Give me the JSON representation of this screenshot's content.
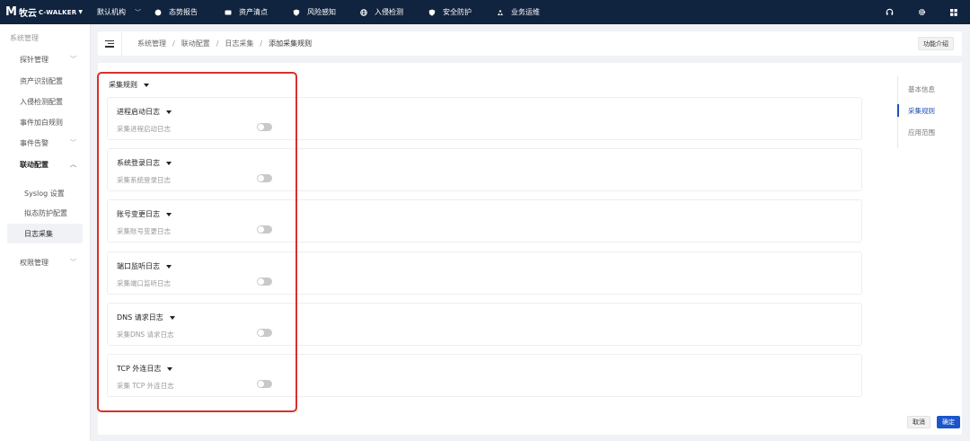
{
  "app": {
    "logo_cn": "牧云",
    "logo_en": "C-WALKER",
    "org": "默认机构",
    "nav": [
      {
        "label": "态势报告",
        "icon": "dashboard-icon"
      },
      {
        "label": "资产清点",
        "icon": "asset-icon"
      },
      {
        "label": "风险感知",
        "icon": "shield-icon"
      },
      {
        "label": "入侵检测",
        "icon": "globe-icon"
      },
      {
        "label": "安全防护",
        "icon": "shield-check-icon"
      },
      {
        "label": "业务运维",
        "icon": "recycle-icon"
      }
    ]
  },
  "sidebar": {
    "title": "系统管理",
    "items": [
      {
        "label": "探针管理"
      },
      {
        "label": "资产识别配置"
      },
      {
        "label": "入侵检测配置"
      },
      {
        "label": "事件加白规则"
      },
      {
        "label": "事件告警"
      },
      {
        "label": "联动配置"
      },
      {
        "label": "权限管理"
      }
    ],
    "sub_items": [
      {
        "label": "Syslog 设置"
      },
      {
        "label": "拟态防护配置"
      },
      {
        "label": "日志采集"
      }
    ]
  },
  "breadcrumb": [
    "系统管理",
    "联动配置",
    "日志采集",
    "添加采集规则"
  ],
  "func_button": "功能介绍",
  "section_title": "采集规则",
  "rules": [
    {
      "name": "进程启动日志",
      "desc": "采集进程启动日志",
      "enabled": false
    },
    {
      "name": "系统登录日志",
      "desc": "采集系统登录日志",
      "enabled": false
    },
    {
      "name": "账号变更日志",
      "desc": "采集账号变更日志",
      "enabled": false
    },
    {
      "name": "端口监听日志",
      "desc": "采集端口监听日志",
      "enabled": false
    },
    {
      "name": "DNS 请求日志",
      "desc": "采集DNS 请求日志",
      "enabled": false
    },
    {
      "name": "TCP 外连日志",
      "desc": "采集 TCP 外连日志",
      "enabled": false
    }
  ],
  "anchor": [
    "基本信息",
    "采集规则",
    "应用范围"
  ],
  "buttons": {
    "cancel": "取消",
    "ok": "确定"
  },
  "colors": {
    "topbar": "#10233f",
    "primary": "#1b55c9",
    "highlight": "#d9302b"
  }
}
